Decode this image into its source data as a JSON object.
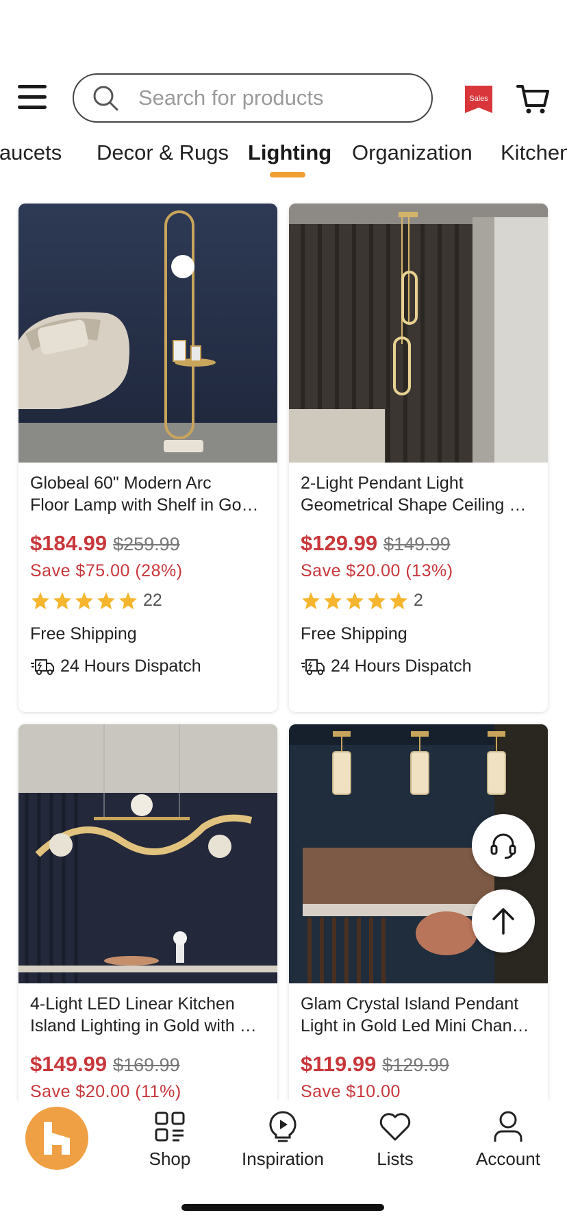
{
  "search": {
    "placeholder": "Search for products"
  },
  "header": {
    "sales_badge": "Sales"
  },
  "tabs": [
    {
      "label": "Faucets"
    },
    {
      "label": "Decor & Rugs"
    },
    {
      "label": "Lighting",
      "active": true
    },
    {
      "label": "Organization"
    },
    {
      "label": "Kitchen"
    }
  ],
  "products": [
    {
      "title_line1": "Globeal 60\" Modern Arc",
      "title_line2": "Floor Lamp with Shelf in Go…",
      "price": "$184.99",
      "old_price": "$259.99",
      "save": "Save $75.00 (28%)",
      "rating": 5,
      "review_count": "22",
      "shipping": "Free Shipping",
      "dispatch": "24 Hours Dispatch"
    },
    {
      "title_line1": "2-Light Pendant Light",
      "title_line2": "Geometrical Shape Ceiling …",
      "price": "$129.99",
      "old_price": "$149.99",
      "save": "Save $20.00 (13%)",
      "rating": 5,
      "review_count": "2",
      "shipping": "Free Shipping",
      "dispatch": "24 Hours Dispatch"
    },
    {
      "title_line1": "4-Light LED Linear Kitchen",
      "title_line2": "Island Lighting in Gold with …",
      "price": "$149.99",
      "old_price": "$169.99",
      "save": "Save $20.00 (11%)"
    },
    {
      "title_line1": "Glam Crystal Island Pendant",
      "title_line2": "Light in Gold Led Mini Chan…",
      "price": "$119.99",
      "old_price": "$129.99",
      "save": "Save $10.00"
    }
  ],
  "bottom_nav": {
    "items": [
      {
        "label": "Shop",
        "icon": "grid-list-icon"
      },
      {
        "label": "Inspiration",
        "icon": "lightbulb-play-icon"
      },
      {
        "label": "Lists",
        "icon": "heart-icon"
      },
      {
        "label": "Account",
        "icon": "person-icon"
      }
    ]
  },
  "colors": {
    "accent": "#f0a033",
    "price_red": "#c8373b",
    "star": "#f5b52e"
  }
}
